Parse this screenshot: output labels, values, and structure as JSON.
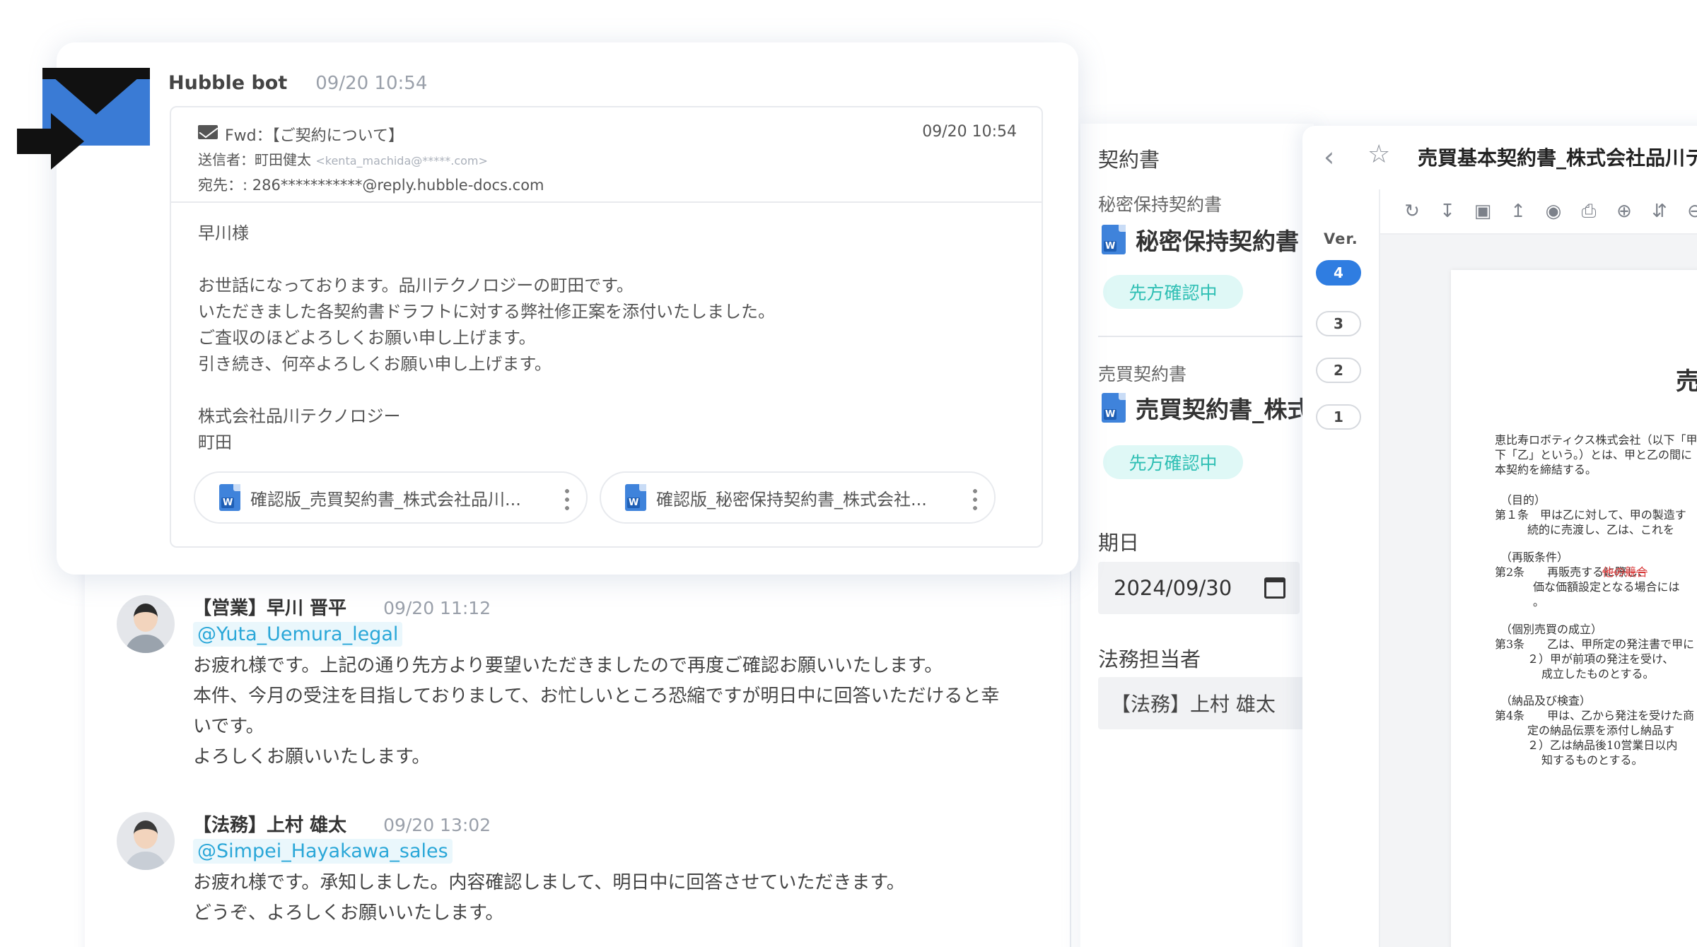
{
  "email_card": {
    "sender": "Hubble bot",
    "time": "09/20 10:54",
    "subject": "Fwd：【ご契約について】",
    "date": "09/20 10:54",
    "from_label": "送信者：町田健太",
    "from_addr": "<kenta_machida@*****.com>",
    "to": "宛先：: 286***********@reply.hubble-docs.com",
    "body": [
      "早川様",
      "",
      "お世話になっております。品川テクノロジーの町田です。",
      "いただきました各契約書ドラフトに対する弊社修正案を添付いたしました。",
      "ご査収のほどよろしくお願い申し上げます。",
      "引き続き、何卒よろしくお願い申し上げます。",
      "",
      "株式会社品川テクノロジー",
      "町田"
    ],
    "attachments": [
      {
        "name": "確認版_売買契約書_株式会社品川...",
        "icon": "word-file-icon"
      },
      {
        "name": "確認版_秘密保持契約書_株式会社...",
        "icon": "word-file-icon"
      }
    ]
  },
  "chat": {
    "messages": [
      {
        "author": "【営業】早川 晋平",
        "time": "09/20 11:12",
        "mention": "@Yuta_Uemura_legal",
        "lines": [
          "お疲れ様です。上記の通り先方より要望いただきましたので再度ご確認お願いいたします。",
          "本件、今月の受注を目指しておりまして、お忙しいところ恐縮ですが明日中に回答いただけると幸",
          "いです。",
          "よろしくお願いいたします。"
        ]
      },
      {
        "author": "【法務】上村 雄太",
        "time": "09/20 13:02",
        "mention": "@Simpei_Hayakawa_sales",
        "lines": [
          "お疲れ様です。承知しました。内容確認しまして、明日中に回答させていただきます。",
          "どうぞ、よろしくお願いいたします。"
        ]
      }
    ]
  },
  "form_panel": {
    "heading": "契約書",
    "docs": [
      {
        "category": "秘密保持契約書",
        "title": "秘密保持契約書",
        "status": "先方確認中"
      },
      {
        "category": "売買契約書",
        "title": "売買契約書_株式",
        "status": "先方確認中"
      }
    ],
    "due_label": "期日",
    "due_value": "2024/09/30",
    "assignee_label": "法務担当者",
    "assignee_value": "【法務】上村 雄太"
  },
  "viewer": {
    "title": "売買基本契約書_株式会社品川テ",
    "ver_label": "Ver.",
    "versions": [
      "4",
      "3",
      "2",
      "1"
    ],
    "active_version": "4",
    "tools": [
      "refresh-icon",
      "download-icon",
      "copy-icon",
      "upload-icon",
      "eye-icon",
      "print-icon",
      "zoom-in-icon",
      "collapse-icon",
      "zoom-out-icon"
    ],
    "page": {
      "title": "売買",
      "lines": [
        "恵比寿ロボティクス株式会社（以下「甲",
        "下「乙」という。）とは、甲と乙の間に",
        "本契約を締結する。",
        "（目的）",
        "第１条　甲は乙に対して、甲の製造す",
        "続的に売渡し、乙は、これを",
        "（再販条件）",
        "第2条　　再販売するに際し、",
        "他の競合",
        "価な価額設定となる場合には",
        "。",
        "（個別売買の成立）",
        "第3条　　乙は、甲所定の発注書で甲に",
        "２）甲が前項の発注を受け、",
        "成立したものとする。",
        "（納品及び検査）",
        "第4条　　甲は、乙から発注を受けた商",
        "定の納品伝票を添付し納品す",
        "２）乙は納品後10営業日以内",
        "知するものとする。"
      ]
    }
  },
  "colors": {
    "accent": "#2f7de1",
    "mention": "#2aa7d8",
    "badge_bg": "#dff8f6",
    "badge_text": "#2fbfb4"
  }
}
